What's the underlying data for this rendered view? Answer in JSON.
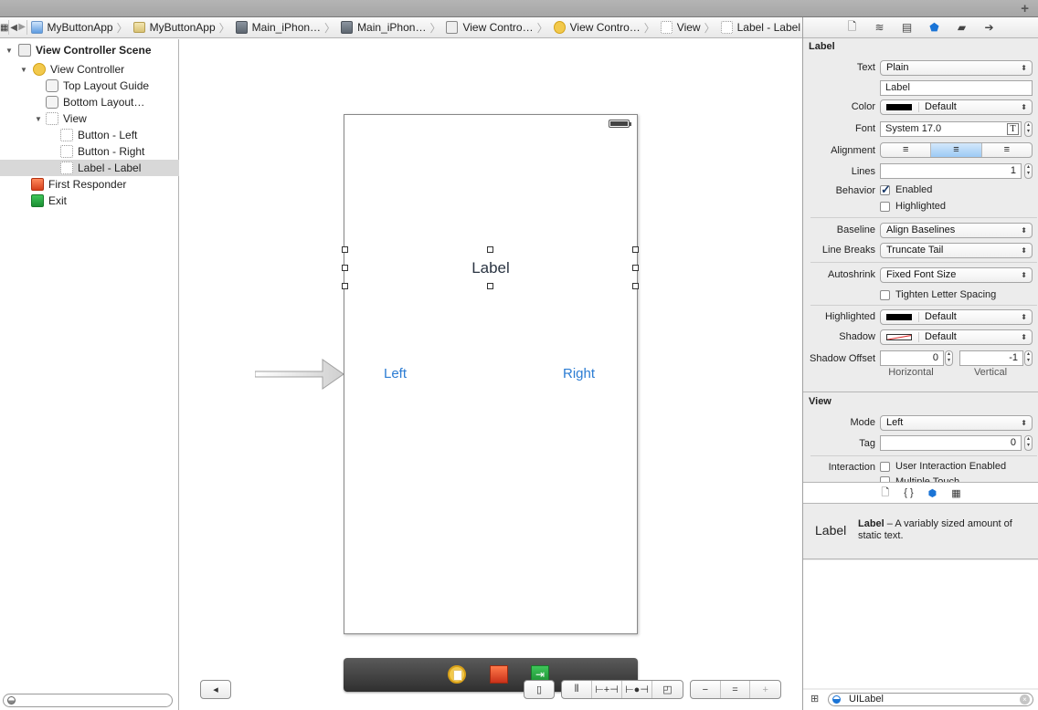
{
  "window": {
    "add_icon": "+"
  },
  "jumpbar": {
    "grid_icon": "▦",
    "back_icon": "◀",
    "forward_icon": "▶",
    "crumbs": [
      {
        "label": "MyButtonApp",
        "icon": "project-icon"
      },
      {
        "label": "MyButtonApp",
        "icon": "folder-icon"
      },
      {
        "label": "Main_iPhon…",
        "icon": "storyboard-icon"
      },
      {
        "label": "Main_iPhon…",
        "icon": "storyboard-icon"
      },
      {
        "label": "View Contro…",
        "icon": "scene-icon"
      },
      {
        "label": "View Contro…",
        "icon": "view-controller-icon"
      },
      {
        "label": "View",
        "icon": "view-icon"
      },
      {
        "label": "Label - Label",
        "icon": "view-icon"
      }
    ],
    "separator": "〉"
  },
  "outline": {
    "items": [
      {
        "label": "View Controller Scene",
        "icon": "scene-icon",
        "expanded": true
      },
      {
        "label": "View Controller",
        "icon": "view-controller-icon",
        "expanded": true
      },
      {
        "label": "Top Layout Guide",
        "icon": "layout-guide-icon"
      },
      {
        "label": "Bottom Layout…",
        "icon": "layout-guide-icon"
      },
      {
        "label": "View",
        "icon": "view-icon",
        "expanded": true
      },
      {
        "label": "Button - Left",
        "icon": "view-icon"
      },
      {
        "label": "Button - Right",
        "icon": "view-icon"
      },
      {
        "label": "Label - Label",
        "icon": "view-icon",
        "selected": true
      },
      {
        "label": "First Responder",
        "icon": "first-responder-icon"
      },
      {
        "label": "Exit",
        "icon": "exit-icon"
      }
    ],
    "filter_placeholder": ""
  },
  "canvas": {
    "label_text": "Label",
    "button_left": "Left",
    "button_right": "Right",
    "label_color": "#2a3442",
    "button_color": "#2b7cd3",
    "toolbar": {
      "toggle_outline_icon": "◂",
      "resize_icon": "▯",
      "align_icon": "⫴",
      "pin_icon": "⊢+⊣",
      "resolve_icon": "⊢●⊣",
      "resizing_icon": "◰",
      "zoom_out_icon": "−",
      "zoom_actual_icon": "=",
      "zoom_in_icon": "+"
    }
  },
  "inspector": {
    "tabs": [
      "file",
      "quick-help",
      "identity",
      "attributes",
      "size",
      "connections"
    ],
    "label_section": {
      "title": "Label",
      "text_label": "Text",
      "text_value": "Plain",
      "text_field_value": "Label",
      "color_label": "Color",
      "color_value": "Default",
      "font_label": "Font",
      "font_value": "System 17.0",
      "alignment_label": "Alignment",
      "alignment_selected": "center",
      "lines_label": "Lines",
      "lines_value": "1",
      "behavior_label": "Behavior",
      "enabled_label": "Enabled",
      "enabled_checked": true,
      "highlighted_label": "Highlighted",
      "highlighted_checked": false,
      "baseline_label": "Baseline",
      "baseline_value": "Align Baselines",
      "linebreaks_label": "Line Breaks",
      "linebreaks_value": "Truncate Tail",
      "autoshrink_label": "Autoshrink",
      "autoshrink_value": "Fixed Font Size",
      "tighten_label": "Tighten Letter Spacing",
      "tighten_checked": false,
      "highlighted_color_label": "Highlighted",
      "highlighted_color_value": "Default",
      "shadow_label": "Shadow",
      "shadow_value": "Default",
      "shadow_offset_label": "Shadow Offset",
      "shadow_h_value": "0",
      "shadow_v_value": "-1",
      "horizontal_label": "Horizontal",
      "vertical_label": "Vertical"
    },
    "view_section": {
      "title": "View",
      "mode_label": "Mode",
      "mode_value": "Left",
      "tag_label": "Tag",
      "tag_value": "0",
      "interaction_label": "Interaction",
      "user_interaction_label": "User Interaction Enabled",
      "user_interaction_checked": false,
      "multiple_touch_label": "Multiple Touch"
    },
    "library": {
      "tabs": [
        "file-template",
        "code-snippet",
        "object",
        "media"
      ],
      "item_preview": "Label",
      "item_title": "Label",
      "item_desc": " – A variably sized amount of static text.",
      "search_value": "UILabel"
    }
  }
}
